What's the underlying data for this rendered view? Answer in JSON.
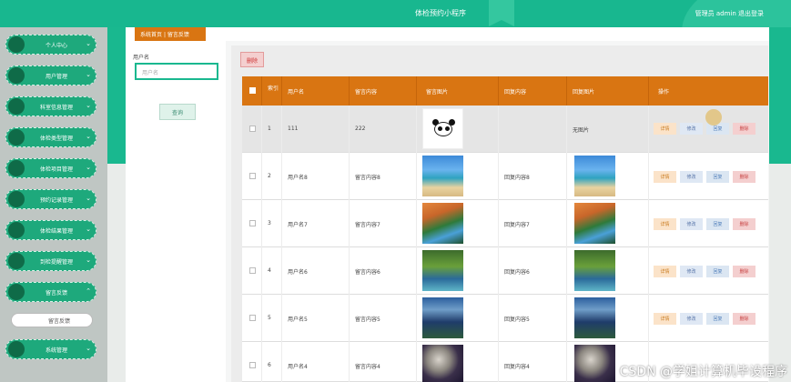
{
  "header": {
    "title": "体检预约小程序",
    "admin": "管理员 admin  退出登录"
  },
  "sidebar": {
    "items": [
      {
        "label": "个人中心",
        "expanded": false
      },
      {
        "label": "用户管理",
        "expanded": false
      },
      {
        "label": "科室信息管理",
        "expanded": false
      },
      {
        "label": "体检类型管理",
        "expanded": false
      },
      {
        "label": "体检项目管理",
        "expanded": false
      },
      {
        "label": "预约记录管理",
        "expanded": false
      },
      {
        "label": "体检结果管理",
        "expanded": false
      },
      {
        "label": "到检提醒管理",
        "expanded": false
      },
      {
        "label": "留言反馈",
        "expanded": true
      },
      {
        "label": "系统管理",
        "expanded": false
      }
    ],
    "submenu_label": "留言反馈"
  },
  "breadcrumb": {
    "home": "系统首页",
    "separator": "|",
    "current": "留言反馈"
  },
  "search": {
    "label": "用户名",
    "placeholder": "用户名",
    "button": "查询"
  },
  "toolbar": {
    "delete_label": "删除"
  },
  "table": {
    "columns": [
      "",
      "索引",
      "用户名",
      "留言内容",
      "留言图片",
      "回复内容",
      "回复图片",
      "操作"
    ],
    "rows": [
      {
        "index": "1",
        "username": "111",
        "content": "222",
        "image": "panda",
        "reply": "",
        "reply_image": "无图片",
        "selected": true
      },
      {
        "index": "2",
        "username": "用户名8",
        "content": "留言内容8",
        "image": "beach",
        "reply": "回复内容8",
        "reply_image": "beach"
      },
      {
        "index": "3",
        "username": "用户名7",
        "content": "留言内容7",
        "image": "autumn",
        "reply": "回复内容7",
        "reply_image": "autumn"
      },
      {
        "index": "4",
        "username": "用户名6",
        "content": "留言内容6",
        "image": "spring",
        "reply": "回复内容6",
        "reply_image": "spring"
      },
      {
        "index": "5",
        "username": "用户名5",
        "content": "留言内容5",
        "image": "falls",
        "reply": "回复内容5",
        "reply_image": "falls"
      },
      {
        "index": "6",
        "username": "用户名4",
        "content": "留言内容4",
        "image": "moon",
        "reply": "回复内容4",
        "reply_image": "moon"
      }
    ],
    "actions": {
      "detail": "详情",
      "edit": "修改",
      "reply": "回复",
      "delete": "删除"
    }
  },
  "watermark": "CSDN @学姐计算机毕设程序",
  "colors": {
    "primary": "#19b88f",
    "accent": "#d97512"
  }
}
